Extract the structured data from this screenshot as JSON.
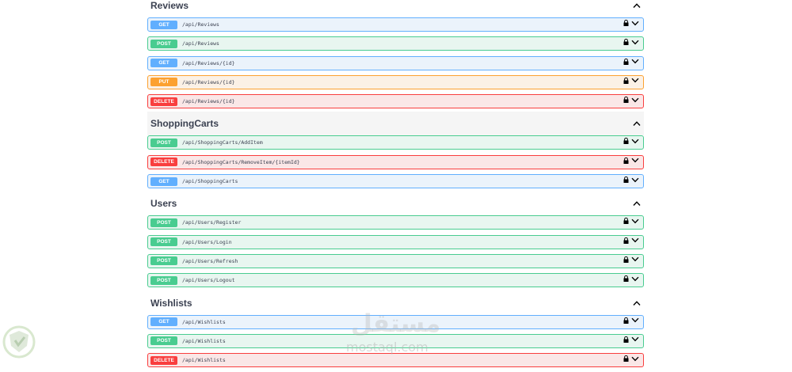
{
  "sections": [
    {
      "title": "Reviews",
      "operations": [
        {
          "method": "GET",
          "path": "/api/Reviews"
        },
        {
          "method": "POST",
          "path": "/api/Reviews"
        },
        {
          "method": "GET",
          "path": "/api/Reviews/{id}"
        },
        {
          "method": "PUT",
          "path": "/api/Reviews/{id}"
        },
        {
          "method": "DELETE",
          "path": "/api/Reviews/{id}"
        }
      ]
    },
    {
      "title": "ShoppingCarts",
      "operations": [
        {
          "method": "POST",
          "path": "/api/ShoppingCarts/AddItem"
        },
        {
          "method": "DELETE",
          "path": "/api/ShoppingCarts/RemoveItem/{itemId}"
        },
        {
          "method": "GET",
          "path": "/api/ShoppingCarts"
        }
      ]
    },
    {
      "title": "Users",
      "operations": [
        {
          "method": "POST",
          "path": "/api/Users/Register"
        },
        {
          "method": "POST",
          "path": "/api/Users/Login"
        },
        {
          "method": "POST",
          "path": "/api/Users/Refresh"
        },
        {
          "method": "POST",
          "path": "/api/Users/Logout"
        }
      ]
    },
    {
      "title": "Wishlists",
      "operations": [
        {
          "method": "GET",
          "path": "/api/Wishlists"
        },
        {
          "method": "POST",
          "path": "/api/Wishlists"
        },
        {
          "method": "DELETE",
          "path": "/api/Wishlists"
        }
      ]
    }
  ],
  "watermark": {
    "logo_text": "مستقل",
    "domain": "mostaql.com"
  },
  "colors": {
    "get": "#61affe",
    "post": "#49cc90",
    "put": "#fca130",
    "delete": "#f93e3e"
  },
  "icons": {
    "lock": "lock-icon",
    "expand": "chevron-down-icon",
    "collapse": "chevron-up-icon"
  }
}
